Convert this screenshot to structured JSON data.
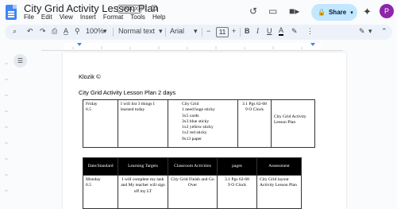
{
  "header": {
    "title": "City Grid Activity Lesson Plan",
    "badge": ".DOCX",
    "menu": [
      "File",
      "Edit",
      "View",
      "Insert",
      "Format",
      "Tools",
      "Help"
    ],
    "share_label": "Share",
    "avatar_letter": "P"
  },
  "toolbar": {
    "zoom": "100%",
    "style": "Normal text",
    "font": "Arial",
    "font_size": "11"
  },
  "document": {
    "header_line": "Klozik ©",
    "heading": "City Grid Activity Lesson Plan 2 days",
    "table1": {
      "row": [
        "Friday\n6.5",
        "I will list 3 things I learned today",
        "City Grid\n1 need huge sticky\n3x5 cards\n3x3 blue sticky\n1x2 yellow sticky\n1x2 red sticky\n9x13 paper",
        "3.1 Pgs 62-68\n9 O Clock",
        "City Grid Activity Lesson Plan"
      ]
    },
    "table2": {
      "headers": [
        "Date/Standard",
        "Learning Targets",
        "Classroom Activities",
        "pages",
        "Assessment"
      ],
      "row": [
        "Monday\n6.5",
        "I will complete my task and My teacher  will sign off my LT",
        "City Grid Finish and Go Over",
        "3.1 Pgs 62-68\n9 O Clock",
        "City Grid layout Activity Lesson Plan"
      ]
    }
  }
}
